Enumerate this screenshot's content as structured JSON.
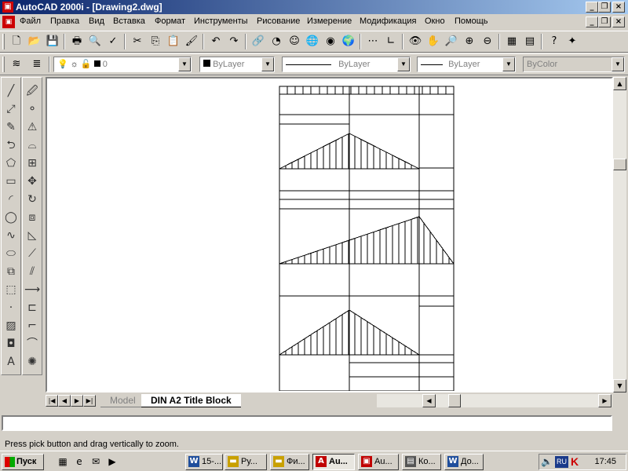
{
  "window": {
    "app_title": "AutoCAD 2000i - [Drawing2.dwg]",
    "app_icon": "autocad-icon",
    "app_icon_glyph": "▣"
  },
  "menu": {
    "items": [
      "Файл",
      "Правка",
      "Вид",
      "Вставка",
      "Формат",
      "Инструменты",
      "Рисование",
      "Измерение",
      "Модификация",
      "Окно",
      "Помощь"
    ]
  },
  "toolbar_standard": {
    "buttons": [
      {
        "name": "new-icon",
        "glyph": "🗋"
      },
      {
        "name": "open-icon",
        "glyph": "📂"
      },
      {
        "name": "save-icon",
        "glyph": "💾"
      },
      {
        "name": "print-icon",
        "glyph": "🖶"
      },
      {
        "name": "print-preview-icon",
        "glyph": "🔍"
      },
      {
        "name": "spell-check-icon",
        "glyph": "✓"
      },
      {
        "name": "cut-icon",
        "glyph": "✂"
      },
      {
        "name": "copy-icon",
        "glyph": "⎘"
      },
      {
        "name": "paste-icon",
        "glyph": "📋"
      },
      {
        "name": "match-properties-icon",
        "glyph": "🖌"
      },
      {
        "name": "undo-icon",
        "glyph": "↶"
      },
      {
        "name": "redo-icon",
        "glyph": "↷"
      },
      {
        "name": "hyperlink-icon",
        "glyph": "🔗"
      },
      {
        "name": "today-icon",
        "glyph": "◔"
      },
      {
        "name": "meet-now-icon",
        "glyph": "☺"
      },
      {
        "name": "publish-icon",
        "glyph": "🌐"
      },
      {
        "name": "point-now-icon",
        "glyph": "◉"
      },
      {
        "name": "web-icon",
        "glyph": "🌍"
      },
      {
        "name": "snap-from-icon",
        "glyph": "⋯"
      },
      {
        "name": "ucs-icon",
        "glyph": "∟"
      },
      {
        "name": "named-views-icon",
        "glyph": "👁"
      },
      {
        "name": "pan-icon",
        "glyph": "✋"
      },
      {
        "name": "zoom-realtime-icon",
        "glyph": "🔎"
      },
      {
        "name": "zoom-window-icon",
        "glyph": "⊕"
      },
      {
        "name": "zoom-previous-icon",
        "glyph": "⊖"
      },
      {
        "name": "properties-icon",
        "glyph": "▦"
      },
      {
        "name": "design-center-icon",
        "glyph": "▤"
      },
      {
        "name": "help-icon",
        "glyph": "?"
      },
      {
        "name": "active-assistance-icon",
        "glyph": "✦"
      }
    ]
  },
  "toolbar_layers": {
    "layer_value": "0",
    "color_value": "ByLayer",
    "linetype_value": "ByLayer",
    "lineweight_value": "ByLayer",
    "plotstyle_value": "ByColor"
  },
  "left_toolbar_draw": [
    {
      "name": "line-icon",
      "glyph": "╱"
    },
    {
      "name": "construction-line-icon",
      "glyph": "⤢"
    },
    {
      "name": "multiline-icon",
      "glyph": "✎"
    },
    {
      "name": "polyline-icon",
      "glyph": "⮌"
    },
    {
      "name": "polygon-icon",
      "glyph": "⬠"
    },
    {
      "name": "rectangle-icon",
      "glyph": "▭"
    },
    {
      "name": "arc-icon",
      "glyph": "◜"
    },
    {
      "name": "circle-icon",
      "glyph": "◯"
    },
    {
      "name": "spline-icon",
      "glyph": "∿"
    },
    {
      "name": "ellipse-icon",
      "glyph": "⬭"
    },
    {
      "name": "insert-block-icon",
      "glyph": "⧉"
    },
    {
      "name": "make-block-icon",
      "glyph": "⬚"
    },
    {
      "name": "point-icon",
      "glyph": "·"
    },
    {
      "name": "hatch-icon",
      "glyph": "▨"
    },
    {
      "name": "region-icon",
      "glyph": "◘"
    },
    {
      "name": "multiline-text-icon",
      "glyph": "A"
    }
  ],
  "left_toolbar_modify": [
    {
      "name": "erase-icon",
      "glyph": "🖉"
    },
    {
      "name": "copy-object-icon",
      "glyph": "⚬"
    },
    {
      "name": "mirror-icon",
      "glyph": "⚠"
    },
    {
      "name": "offset-icon",
      "glyph": "⌓"
    },
    {
      "name": "array-icon",
      "glyph": "⊞"
    },
    {
      "name": "move-icon",
      "glyph": "✥"
    },
    {
      "name": "rotate-icon",
      "glyph": "↻"
    },
    {
      "name": "scale-icon",
      "glyph": "⧈"
    },
    {
      "name": "stretch-icon",
      "glyph": "◺"
    },
    {
      "name": "lengthen-icon",
      "glyph": "⟋"
    },
    {
      "name": "trim-icon",
      "glyph": "⫽"
    },
    {
      "name": "extend-icon",
      "glyph": "⟶"
    },
    {
      "name": "break-icon",
      "glyph": "⊏"
    },
    {
      "name": "chamfer-icon",
      "glyph": "⌐"
    },
    {
      "name": "fillet-icon",
      "glyph": "⌒"
    },
    {
      "name": "explode-icon",
      "glyph": "✺"
    }
  ],
  "tabs": {
    "model": "Model",
    "layout": "DIN A2 Title Block"
  },
  "command": {
    "status_message": "Press pick button and drag vertically to zoom."
  },
  "taskbar": {
    "start_label": "Пуск",
    "quick_launch": [
      {
        "name": "show-desktop-icon",
        "glyph": "▦"
      },
      {
        "name": "internet-explorer-icon",
        "glyph": "e"
      },
      {
        "name": "outlook-express-icon",
        "glyph": "✉"
      },
      {
        "name": "media-player-icon",
        "glyph": "▶"
      }
    ],
    "tasks": [
      {
        "label": "15-...",
        "icon": "word-icon",
        "glyph": "W",
        "color": "#1f4e9c",
        "active": false
      },
      {
        "label": "Ру...",
        "icon": "folder-icon",
        "glyph": "▬",
        "color": "#c8a000",
        "active": false
      },
      {
        "label": "Фи...",
        "icon": "folder-icon",
        "glyph": "▬",
        "color": "#c8a000",
        "active": false
      },
      {
        "label": "Au...",
        "icon": "autocad-icon",
        "glyph": "A",
        "color": "#c00000",
        "active": true
      },
      {
        "label": "Au...",
        "icon": "autocad-icon",
        "glyph": "▣",
        "color": "#c00000",
        "active": false
      },
      {
        "label": "Ко...",
        "icon": "clipboard-icon",
        "glyph": "▤",
        "color": "#555555",
        "active": false
      },
      {
        "label": "До...",
        "icon": "word-icon",
        "glyph": "W",
        "color": "#1f4e9c",
        "active": false
      }
    ],
    "tray_language": "RU",
    "clock": "17:45"
  }
}
